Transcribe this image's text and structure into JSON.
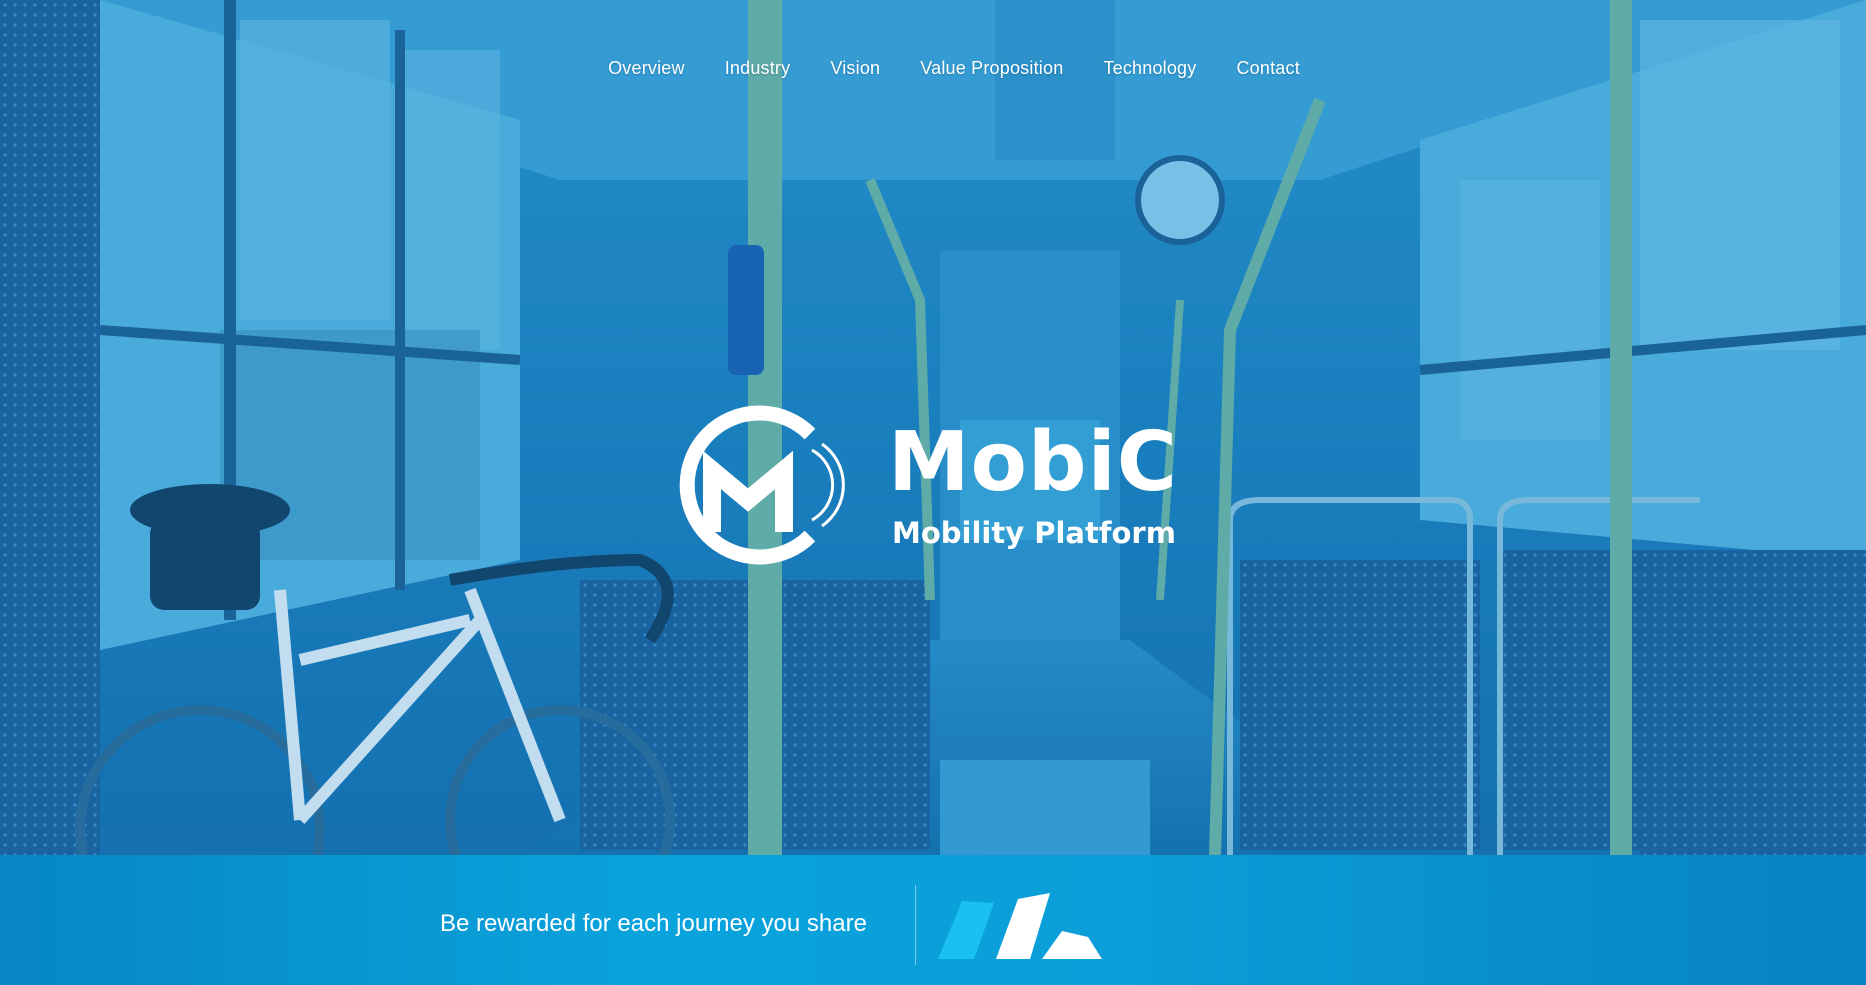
{
  "nav": {
    "items": [
      {
        "label": "Overview"
      },
      {
        "label": "Industry"
      },
      {
        "label": "Vision"
      },
      {
        "label": "Value Proposition"
      },
      {
        "label": "Technology"
      },
      {
        "label": "Contact"
      }
    ]
  },
  "brand": {
    "name": "MobiC",
    "tagline": "Mobility Platform",
    "logo_icon": "mobic-cm-logo-icon"
  },
  "footer": {
    "text": "Be rewarded for each journey you share",
    "logo_icon": "partner-logo-icon"
  },
  "colors": {
    "overlay_blue": "#1d82c0",
    "footer_blue": "#0aa3dc",
    "text": "#ffffff",
    "partner_logo_light": "#19c0f0"
  }
}
